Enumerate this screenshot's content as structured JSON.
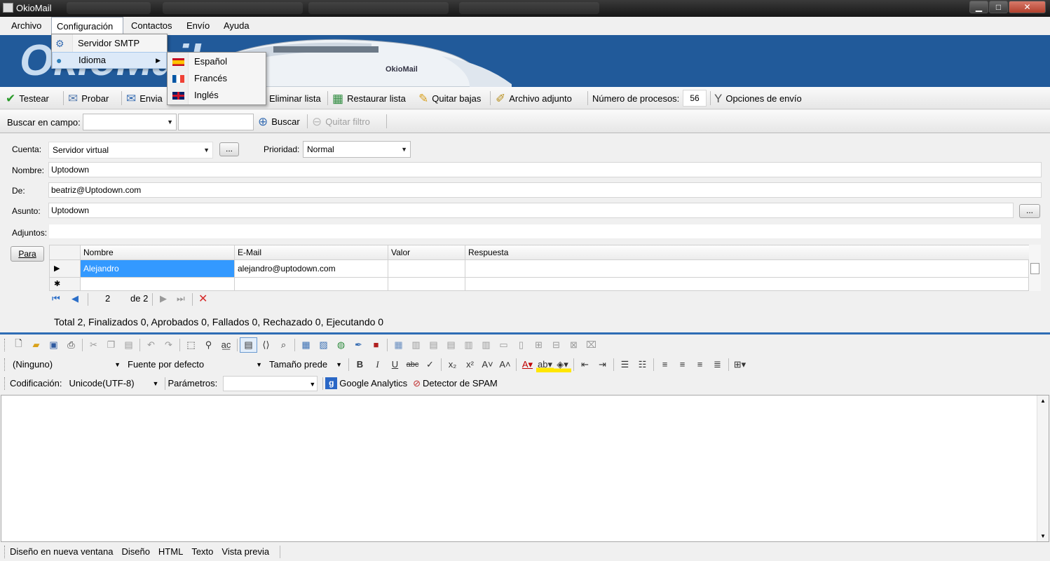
{
  "window": {
    "title": "OkioMail",
    "minimize": "▁",
    "maximize": "□",
    "close": "✕"
  },
  "menu": [
    "Archivo",
    "Configuración",
    "Contactos",
    "Envío",
    "Ayuda"
  ],
  "banner": {
    "logo": "OkioMail",
    "train_label": "OkioMail",
    "accent": "#215a9a"
  },
  "toolbar": {
    "testear": "Testear",
    "probar": "Probar",
    "enviar": "Envia",
    "eliminar": "Eliminar lista",
    "restaurar": "Restaurar lista",
    "quitar_bajas": "Quitar bajas",
    "adjunto": "Archivo adjunto",
    "procesos_label": "Número de procesos:",
    "procesos": "56",
    "opciones": "Opciones de envío"
  },
  "search": {
    "label": "Buscar en campo:",
    "field_value": "",
    "text_value": "",
    "buscar": "Buscar",
    "quitar": "Quitar filtro"
  },
  "form": {
    "cuenta_label": "Cuenta:",
    "cuenta": "Servidor virtual",
    "dots": "...",
    "prioridad_label": "Prioridad:",
    "prioridad": "Normal",
    "nombre_label": "Nombre:",
    "nombre": "Uptodown",
    "de_label": "De:",
    "de": "beatriz@Uptodown.com",
    "asunto_label": "Asunto:",
    "asunto": "Uptodown",
    "adjuntos_label": "Adjuntos:",
    "adjuntos": "",
    "para": "Para"
  },
  "grid": {
    "columns": [
      "Nombre",
      "E-Mail",
      "Valor",
      "Respuesta"
    ],
    "rows": [
      {
        "nombre": "Alejandro",
        "email": "alejandro@uptodown.com",
        "valor": "",
        "respuesta": ""
      }
    ],
    "current_marker": "▶",
    "new_marker": "✱"
  },
  "pager": {
    "current": "2",
    "of": "de 2"
  },
  "status": "Total 2, Finalizados 0, Aprobados 0, Fallados 0, Rechazado 0, Ejecutando 0",
  "editor": {
    "style": "(Ninguno)",
    "font": "Fuente por defecto",
    "size": "Tamaño prede",
    "encoding_label": "Codificación:",
    "encoding": "Unicode(UTF-8)",
    "params_label": "Parámetros:",
    "params": "",
    "ga": "Google Analytics",
    "spam": "Detector de SPAM"
  },
  "tabs": [
    "Diseño en nueva ventana",
    "Diseño",
    "HTML",
    "Texto",
    "Vista previa"
  ],
  "config_menu": {
    "smtp": "Servidor SMTP",
    "idioma": "Idioma"
  },
  "idioma_menu": [
    "Español",
    "Francés",
    "Inglés"
  ]
}
